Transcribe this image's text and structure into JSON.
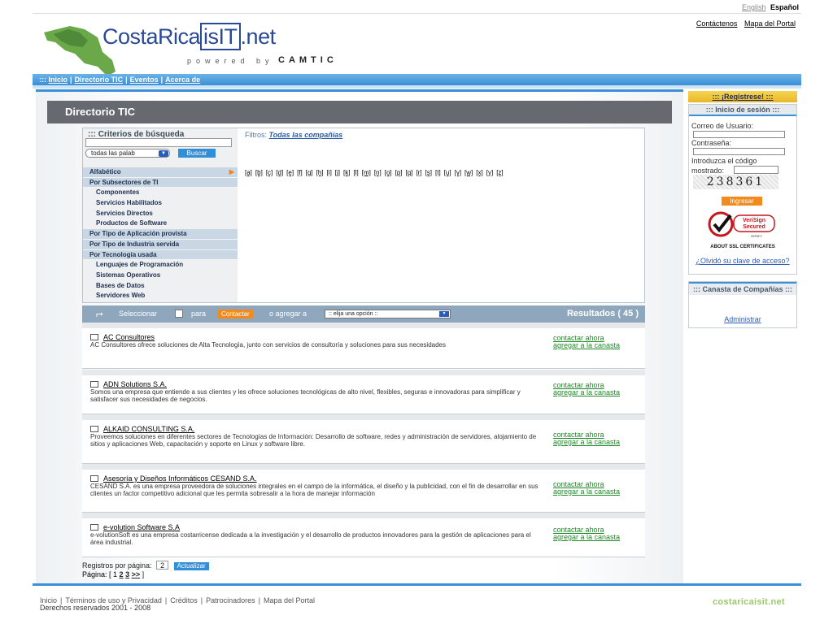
{
  "lang": {
    "english": "English",
    "espanol": "Español"
  },
  "toplinks": {
    "contact": "Contáctenos",
    "sitemap": "Mapa del Portal"
  },
  "logo": {
    "prefix": "CostaRica",
    "boxed": "isIT",
    "suffix": ".net",
    "powered": "powered by",
    "camtic": "CAMTIC"
  },
  "nav": {
    "prefix": ":::",
    "items": [
      "Inicio",
      "Directorio TIC",
      "Eventos",
      "Acerca de"
    ]
  },
  "main": {
    "title": "Directorio TIC",
    "criteria": {
      "title": "::: Criterios de búsqueda",
      "select_value": "todas las palab",
      "search_button": "Buscar",
      "filters_label": "Filtros:",
      "filters_value": "Todas las compañías"
    },
    "menu": [
      {
        "label": "Alfabético",
        "type": "cat"
      },
      {
        "label": "Por Subsectores de TI",
        "type": "cat"
      },
      {
        "label": "Componentes",
        "type": "sub"
      },
      {
        "label": "Servicios Habilitados",
        "type": "sub"
      },
      {
        "label": "Servicios Directos",
        "type": "sub"
      },
      {
        "label": "Productos de Software",
        "type": "sub"
      },
      {
        "label": "Por Tipo de Aplicación provista",
        "type": "cat"
      },
      {
        "label": "Por Tipo de Industria servida",
        "type": "cat"
      },
      {
        "label": "Por Tecnología usada",
        "type": "cat"
      },
      {
        "label": "Lenguajes de Programación",
        "type": "sub"
      },
      {
        "label": "Sistemas Operativos",
        "type": "sub"
      },
      {
        "label": "Bases de Datos",
        "type": "sub"
      },
      {
        "label": "Servidores Web",
        "type": "sub"
      }
    ],
    "letters": [
      "[a]",
      "[b]",
      "[c]",
      "[d]",
      "[e]",
      "[f]",
      "[g]",
      "[h]",
      "[i]",
      "[j]",
      "[k]",
      "[l]",
      "[m]",
      "[n]",
      "[o]",
      "[p]",
      "[q]",
      "[r]",
      "[s]",
      "[t]",
      "[u]",
      "[v]",
      "[w]",
      "[x]",
      "[y]",
      "[z]"
    ],
    "actionbar": {
      "select_label": "Seleccionar",
      "para": "para",
      "contact_button": "Contactar",
      "agregar": "o agregar a",
      "dropdown_value": ":: elija una opción ::",
      "results": "Resultados ( 45 )"
    },
    "results": [
      {
        "name": "AC Consultores",
        "desc": "AC Consultores ofrece soluciones de Alta Tecnología, junto con servicios de consultoría y soluciones para sus necesidades",
        "contact": "contactar ahora",
        "add": "agregar a la canasta"
      },
      {
        "name": "ADN Solutions S.A.",
        "desc": "Somos una empresa que entiende a sus clientes y les ofrece soluciones tecnológicas de alto nivel, flexibles, seguras e innovadoras para simplificar y satisfacer sus necesidades de negocios.",
        "contact": "contactar ahora",
        "add": "agregar a la canasta"
      },
      {
        "name": "ALKAID CONSULTING S.A.",
        "desc": "Proveemos soluciones en diferentes sectores de Tecnologías de Información: Desarrollo de software, redes y administración de servidores, alojamiento de sitios y aplicaciones Web, capacitación y soporte en Linux y software libre.",
        "contact": "contactar ahora",
        "add": "agregar a la canasta"
      },
      {
        "name": "Asesoría y Diseños Informáticos CESAND S.A.",
        "desc": "CESAND S.A. es una empresa proveedora de soluciones integrales en el campo de la informática, el diseño y la publicidad, con el fin de desarrollar en sus clientes un factor competitivo adicional que les permita sobresalir a la hora de manejar información",
        "contact": "contactar ahora",
        "add": "agregar a la canasta"
      },
      {
        "name": "e-volution Software S.A",
        "desc": "e-volutionSoft es una empresa costarricense dedicada a la investigación y el desarrollo de productos innovadores para la gestión de aplicaciones para el área industrial.",
        "contact": "contactar ahora",
        "add": "agregar a la canasta"
      }
    ],
    "pagination": {
      "per_page_label": "Registros por página:",
      "per_page_value": "2",
      "update_button": "Actualizar",
      "page_label": "Página: [ 1",
      "p2": "2",
      "p3": "3",
      "next": ">>",
      "close": "]"
    }
  },
  "sidebar": {
    "register": "::: ¡Registrese! :::",
    "login_title": "::: Inicio de sesión :::",
    "user_label": "Correo de Usuario:",
    "password_label": "Contraseña:",
    "code_label_1": "Introduzca el código",
    "code_label_2": "mostrado:",
    "captcha": "238361",
    "login_button": "Ingresar",
    "verisign_1": "VeriSign",
    "verisign_2": "Secured",
    "verisign_3": "VERIFY",
    "ssl": "ABOUT SSL CERTIFICATES",
    "forgot": "¿Olvidó su clave de acceso?",
    "basket_title": "::: Canasta de Compañías :::",
    "admin": "Administrar"
  },
  "footer": {
    "links": [
      "Inicio",
      "Términos de uso y Privacidad",
      "Créditos",
      "Patrocinadores",
      "Mapa del Portal"
    ],
    "copyright": "Derechos reservados 2001 - 2008",
    "logo": "costaricaisit.net"
  },
  "colors": {
    "accent": "#3b8fd8",
    "orange": "#f28a1c",
    "title_bg": "#666a70",
    "link_green": "#1d8a25"
  }
}
